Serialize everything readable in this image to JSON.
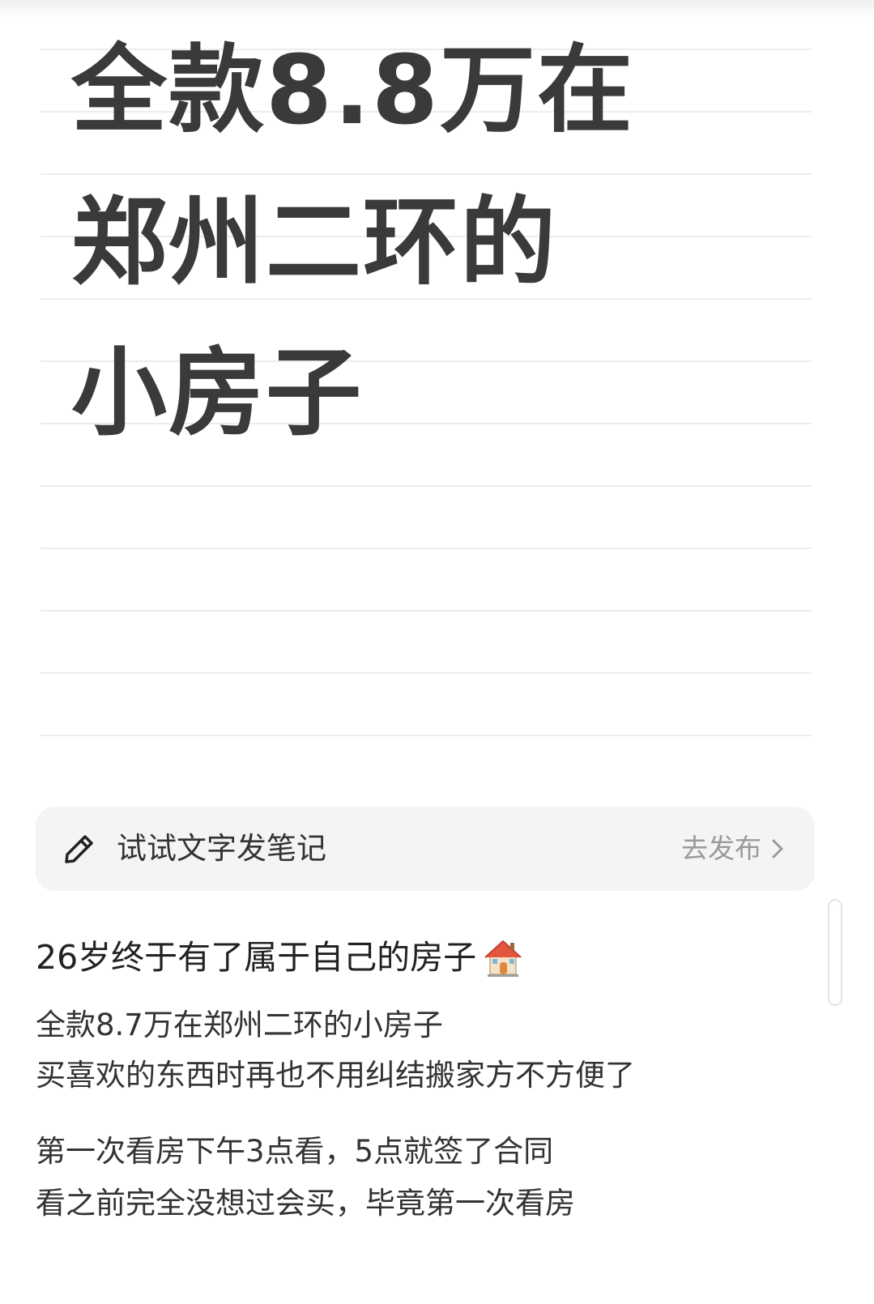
{
  "note_card": {
    "title_lines": [
      "全款8.8万在",
      "郑州二环的",
      "小房子"
    ]
  },
  "compose_bar": {
    "icon": "pencil-icon",
    "label": "试试文字发笔记",
    "action_label": "去发布",
    "action_icon": "chevron-right-icon"
  },
  "post": {
    "title": "26岁终于有了属于自己的房子",
    "title_icon": "house-icon",
    "body_lines": [
      "全款8.7万在郑州二环的小房子",
      "买喜欢的东西时再也不用纠结搬家方不方便了",
      "第一次看房下午3点看，5点就签了合同",
      "看之前完全没想过会买，毕竟第一次看房"
    ]
  },
  "colors": {
    "title_text": "#3a3a3a",
    "body_text": "#333333",
    "muted_text": "#9a9a9a",
    "compose_bg": "#f4f4f4",
    "ruled_line": "#ececec",
    "house_roof": "#e2553f",
    "house_wall": "#f3e3c8"
  }
}
